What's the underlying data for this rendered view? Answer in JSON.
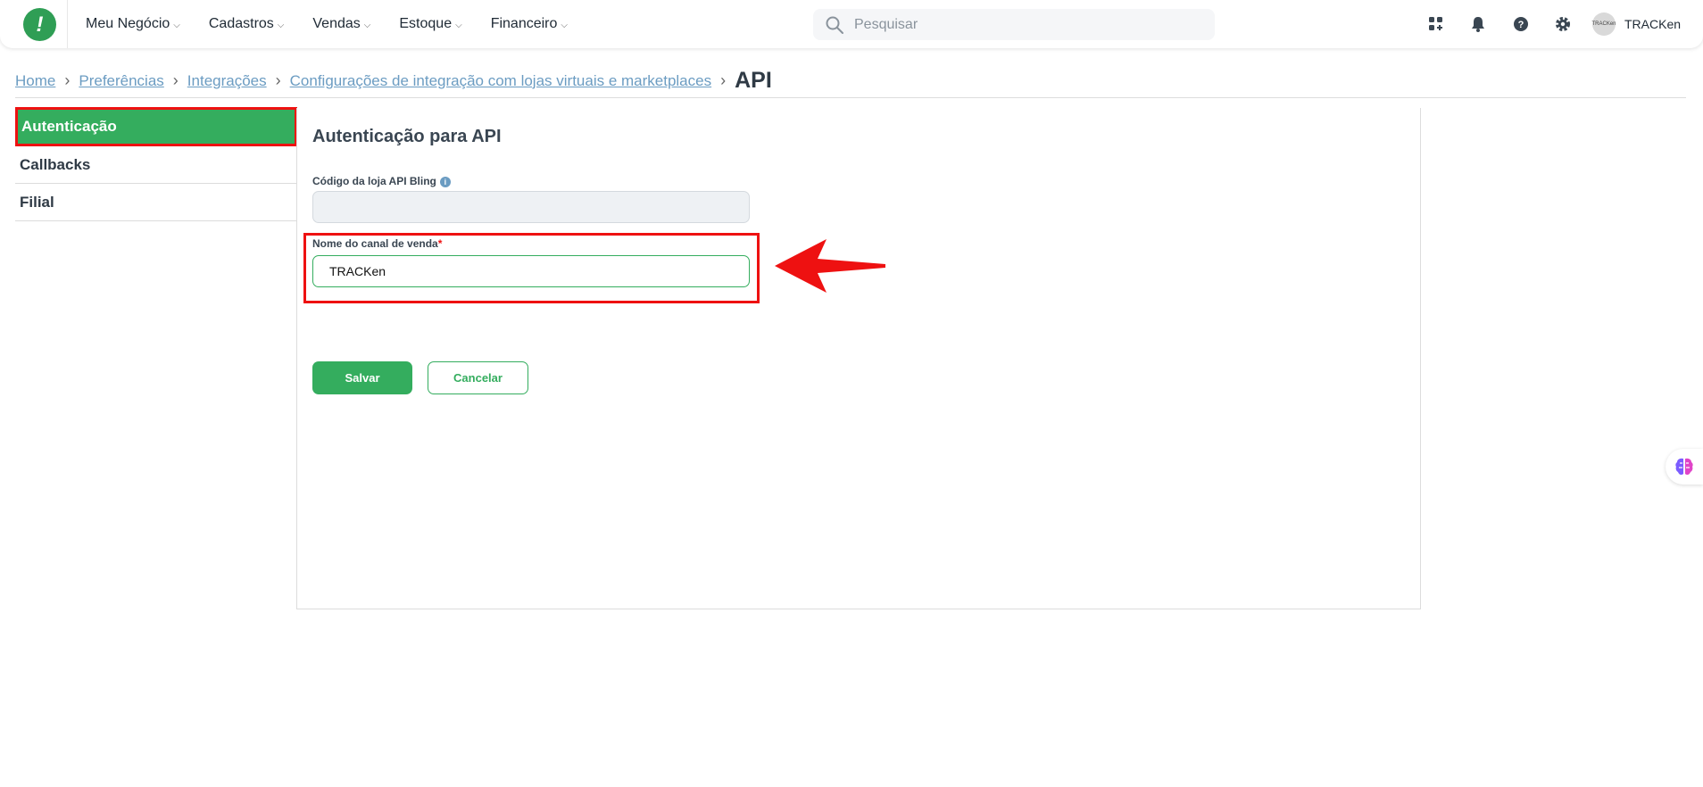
{
  "nav": {
    "items": [
      {
        "label": "Meu Negócio"
      },
      {
        "label": "Cadastros"
      },
      {
        "label": "Vendas"
      },
      {
        "label": "Estoque"
      },
      {
        "label": "Financeiro"
      }
    ]
  },
  "search": {
    "placeholder": "Pesquisar"
  },
  "user": {
    "name": "TRACKen",
    "avatar_text": "TRACKen"
  },
  "breadcrumb": {
    "items": [
      "Home",
      "Preferências",
      "Integrações",
      "Configurações de integração com lojas virtuais e marketplaces"
    ],
    "current": "API"
  },
  "sidebar": {
    "items": [
      {
        "label": "Autenticação"
      },
      {
        "label": "Callbacks"
      },
      {
        "label": "Filial"
      }
    ]
  },
  "form": {
    "title": "Autenticação para API",
    "store_code_label": "Código da loja API Bling",
    "store_code_value": "",
    "channel_label": "Nome do canal de venda",
    "channel_required": "*",
    "channel_value": "TRACKen",
    "save_label": "Salvar",
    "cancel_label": "Cancelar"
  },
  "colors": {
    "brand_green": "#34ad5e",
    "annotation_red": "#ee1111",
    "link_blue": "#6b9cc2"
  },
  "icons": [
    "apps-icon",
    "bell-icon",
    "help-icon",
    "gear-icon",
    "search-icon",
    "info-icon",
    "brain-icon"
  ]
}
